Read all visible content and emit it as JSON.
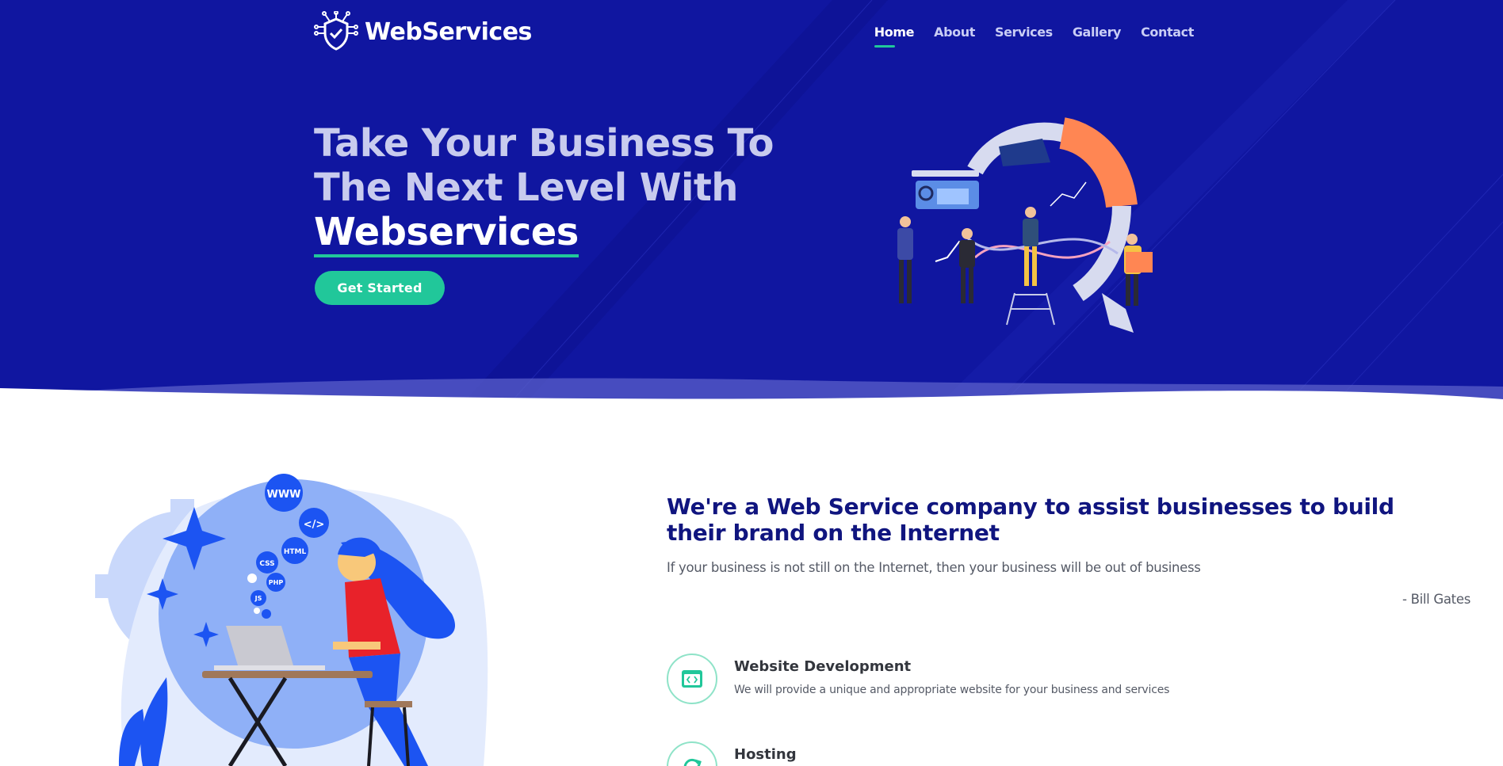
{
  "brand": {
    "name": "WebServices",
    "logo_icon": "shield-circuit-icon"
  },
  "nav": {
    "items": [
      {
        "label": "Home",
        "active": true
      },
      {
        "label": "About",
        "active": false
      },
      {
        "label": "Services",
        "active": false
      },
      {
        "label": "Gallery",
        "active": false
      },
      {
        "label": "Contact",
        "active": false
      }
    ]
  },
  "hero": {
    "title_line1": "Take Your Business To",
    "title_line2": "The Next Level With",
    "title_brand": "Webservices",
    "cta_label": "Get Started",
    "illustration": "team-analytics-illustration"
  },
  "about": {
    "heading": "We're a Web Service company to assist businesses to build their brand on the Internet",
    "quote": "If your business is not still on the Internet, then your business will be out of business",
    "author": "- Bill Gates",
    "illustration": "woman-coding-laptop-illustration",
    "bubbles": [
      "WWW",
      "</>",
      "HTML",
      "CSS",
      "PHP",
      "JS"
    ]
  },
  "services": [
    {
      "title": "Website Development",
      "desc": "We will provide a unique and appropriate website for your business and services",
      "icon": "code-window-icon"
    },
    {
      "title": "Hosting",
      "desc": "",
      "icon": "refresh-icon"
    }
  ],
  "colors": {
    "hero_bg": "#1016a0",
    "accent": "#21c79a",
    "heading": "#10157f"
  }
}
